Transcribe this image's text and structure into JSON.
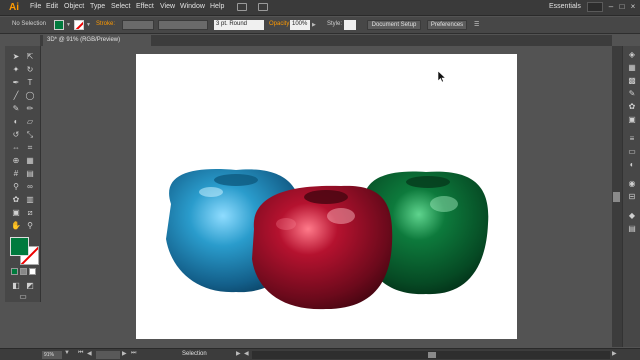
{
  "app": {
    "logo": "Ai",
    "menus": [
      "File",
      "Edit",
      "Object",
      "Type",
      "Select",
      "Effect",
      "View",
      "Window",
      "Help"
    ],
    "workspace": "Essentials",
    "icons": [
      "bridge-icon",
      "arrange-documents-icon",
      "search-icon"
    ]
  },
  "control_bar": {
    "selection_label": "No Selection",
    "stroke_label": "Stroke:",
    "brush_label": "3 pt. Round",
    "opacity_label": "Opacity:",
    "opacity_value": "100%",
    "style_label": "Style:",
    "document_setup": "Document Setup",
    "preferences": "Preferences"
  },
  "document": {
    "tab_title": "3D* @ 91% (RGB/Preview)"
  },
  "status_bar": {
    "zoom": "91%",
    "tool_status": "Selection"
  },
  "colors": {
    "fill": "#007a3d",
    "accent": "#ff9a00",
    "apple_blue": "#1e8fc0",
    "apple_red": "#a0102c",
    "apple_green": "#0b6a35"
  },
  "artwork": {
    "objects": [
      "blue-3d-apple",
      "red-3d-apple",
      "green-3d-apple"
    ]
  }
}
